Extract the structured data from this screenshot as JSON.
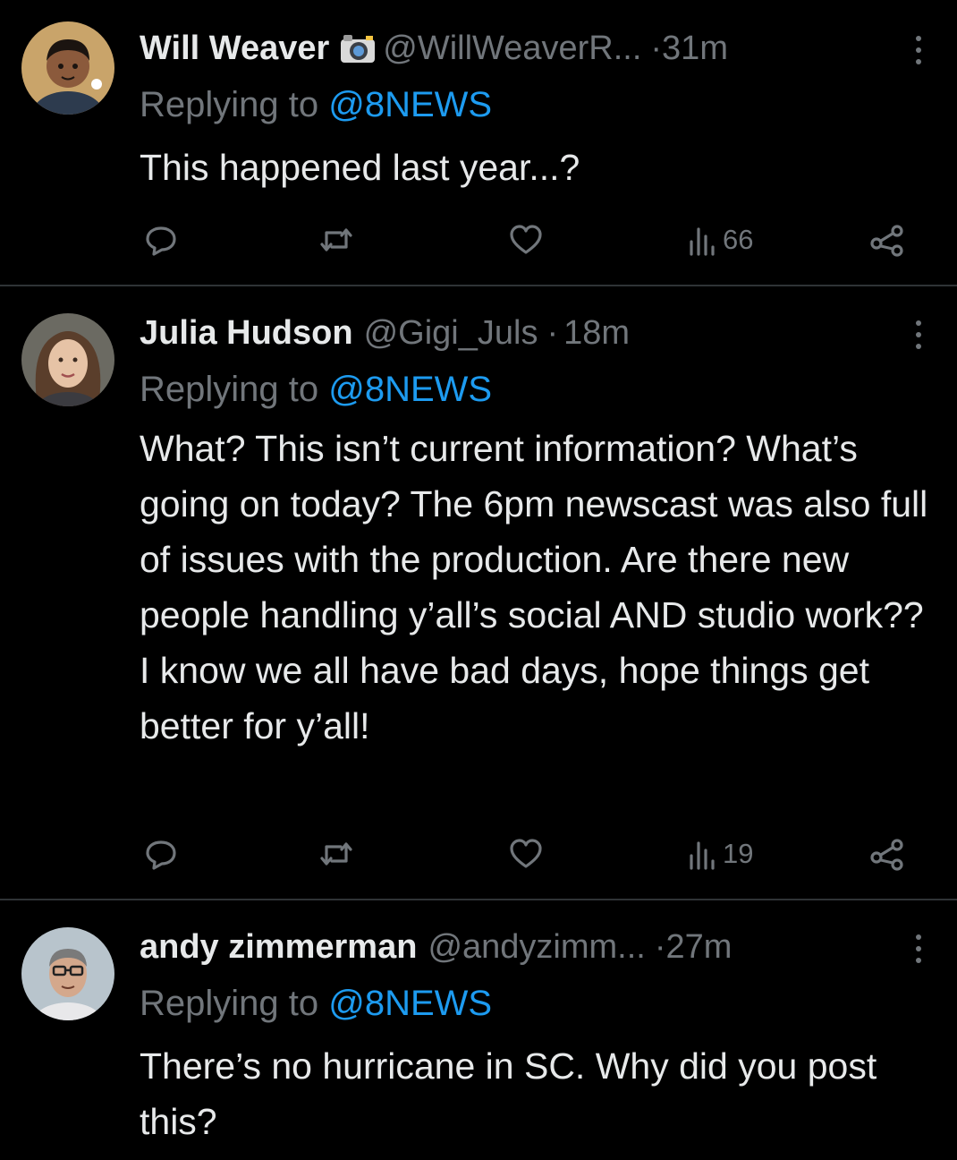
{
  "tweets": [
    {
      "name": "Will Weaver",
      "handle": "@WillWeaverR...",
      "time": "31m",
      "replying_prefix": "Replying to ",
      "replying_mention": "@8NEWS",
      "text": "This happened last year...?",
      "views": "66",
      "avatar_bg": "#c9a46a"
    },
    {
      "name": "Julia Hudson",
      "handle": "@Gigi_Juls",
      "time": "18m",
      "replying_prefix": "Replying to ",
      "replying_mention": "@8NEWS",
      "text": "What? This isn’t current information? What’s going on today? The 6pm newscast was also full of issues with the production. Are there new people handling y’all’s social AND studio work?? I know we all have bad days, hope things get better for y’all!",
      "views": "19",
      "avatar_bg": "#8a7a6e"
    },
    {
      "name": "andy zimmerman",
      "handle": "@andyzimm...",
      "time": "27m",
      "replying_prefix": "Replying to ",
      "replying_mention": "@8NEWS",
      "text": "There’s no hurricane in SC. Why did you post this?",
      "avatar_bg": "#9aa0a6"
    }
  ],
  "icons": [
    "reply-icon",
    "retweet-icon",
    "like-icon",
    "views-icon",
    "share-icon",
    "more-icon",
    "camera-emoji-icon"
  ],
  "colors": {
    "background": "#000000",
    "text": "#e7e9ea",
    "secondary": "#71767b",
    "mention": "#1d9bf0",
    "divider": "#2f3336"
  }
}
